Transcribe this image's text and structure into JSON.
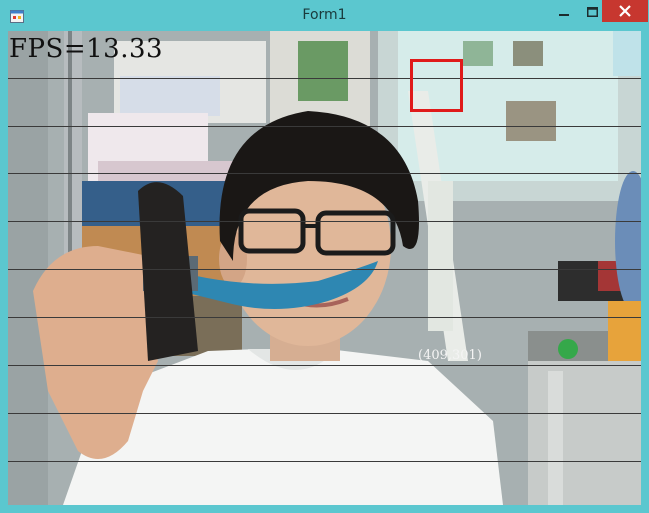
{
  "window": {
    "title": "Form1",
    "accent": "#5bc7cf",
    "close_color": "#c7372f"
  },
  "icons": {
    "app": "app-form-icon",
    "minimize": "minimize-icon",
    "maximize": "maximize-icon",
    "close": "close-icon"
  },
  "overlay": {
    "fps": "FPS=13.33",
    "coordinates": "(409,301)",
    "roi_color": "#e01a1a"
  }
}
